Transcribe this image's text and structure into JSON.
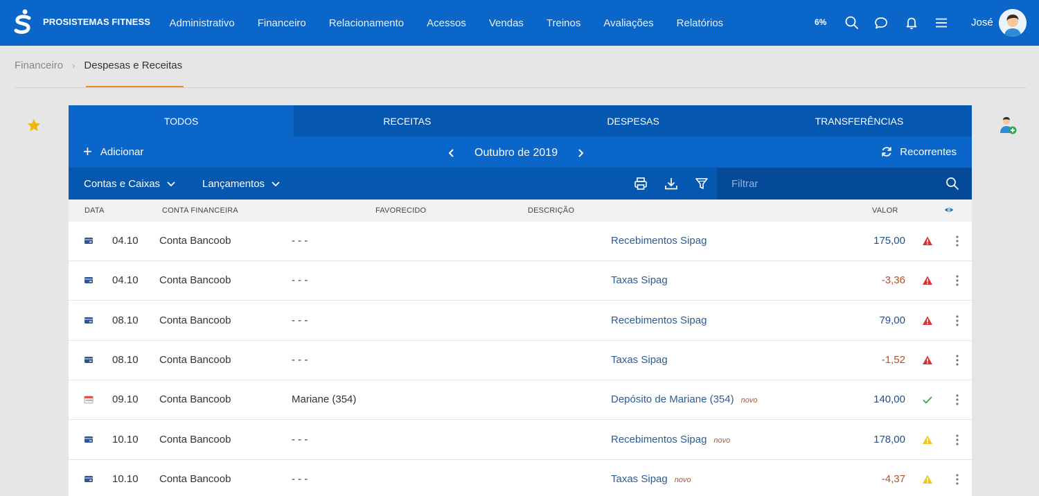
{
  "app": {
    "brand": "PROSISTEMAS FITNESS",
    "nav": [
      "Administrativo",
      "Financeiro",
      "Relacionamento",
      "Acessos",
      "Vendas",
      "Treinos",
      "Avaliações",
      "Relatórios"
    ],
    "percent": "6%",
    "user": "José"
  },
  "breadcrumb": {
    "parent": "Financeiro",
    "current": "Despesas e Receitas"
  },
  "tabs": [
    "TODOS",
    "RECEITAS",
    "DESPESAS",
    "TRANSFERÊNCIAS"
  ],
  "actions": {
    "add": "Adicionar",
    "month": "Outubro de 2019",
    "recorrentes": "Recorrentes"
  },
  "filters": {
    "contas": "Contas e Caixas",
    "lancamentos": "Lançamentos",
    "placeholder": "Filtrar"
  },
  "columns": {
    "data": "DATA",
    "conta": "CONTA FINANCEIRA",
    "favorecido": "FAVORECIDO",
    "descricao": "DESCRIÇÃO",
    "valor": "VALOR"
  },
  "rows": [
    {
      "icon": "card",
      "date": "04.10",
      "conta": "Conta Bancoob",
      "favorecido": "- - -",
      "descricao": "Recebimentos Sipag",
      "novo": "",
      "valor": "175,00",
      "sign": "pos",
      "status": "alert-red"
    },
    {
      "icon": "card",
      "date": "04.10",
      "conta": "Conta Bancoob",
      "favorecido": "- - -",
      "descricao": "Taxas Sipag",
      "novo": "",
      "valor": "-3,36",
      "sign": "neg",
      "status": "alert-red"
    },
    {
      "icon": "card",
      "date": "08.10",
      "conta": "Conta Bancoob",
      "favorecido": "- - -",
      "descricao": "Recebimentos Sipag",
      "novo": "",
      "valor": "79,00",
      "sign": "pos",
      "status": "alert-red"
    },
    {
      "icon": "card",
      "date": "08.10",
      "conta": "Conta Bancoob",
      "favorecido": "- - -",
      "descricao": "Taxas Sipag",
      "novo": "",
      "valor": "-1,52",
      "sign": "neg",
      "status": "alert-red"
    },
    {
      "icon": "calendar",
      "date": "09.10",
      "conta": "Conta Bancoob",
      "favorecido": "Mariane (354)",
      "descricao": "Depósito de Mariane (354)",
      "novo": "novo",
      "valor": "140,00",
      "sign": "pos",
      "status": "check"
    },
    {
      "icon": "card",
      "date": "10.10",
      "conta": "Conta Bancoob",
      "favorecido": "- - -",
      "descricao": "Recebimentos Sipag",
      "novo": "novo",
      "valor": "178,00",
      "sign": "pos",
      "status": "alert-yellow"
    },
    {
      "icon": "card",
      "date": "10.10",
      "conta": "Conta Bancoob",
      "favorecido": "- - -",
      "descricao": "Taxas Sipag",
      "novo": "novo",
      "valor": "-4,37",
      "sign": "neg",
      "status": "alert-yellow"
    }
  ],
  "colors": {
    "primary": "#0a66c9",
    "primary_dark": "#0557b0",
    "accent": "#f08c1e",
    "positive": "#1f4f8f",
    "negative": "#b2502c"
  }
}
